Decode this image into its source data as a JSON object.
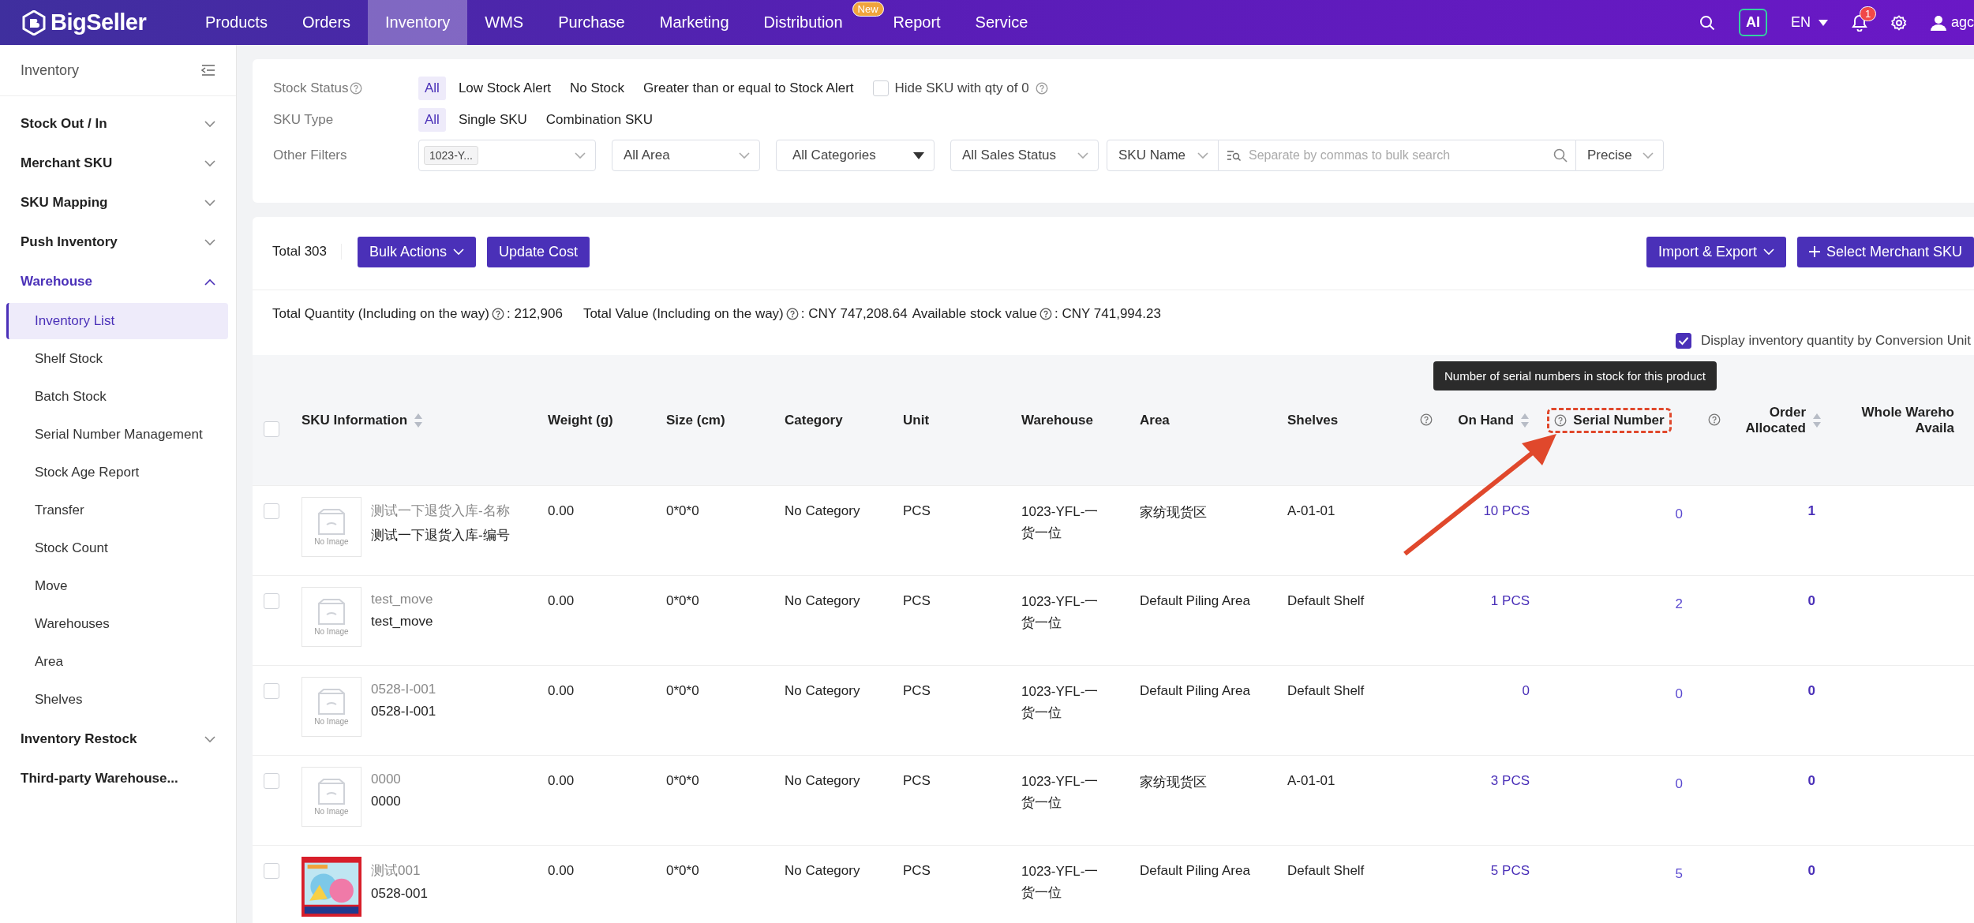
{
  "topbar": {
    "logo": "BigSeller",
    "nav": [
      {
        "label": "Products",
        "selected": false
      },
      {
        "label": "Orders",
        "selected": false
      },
      {
        "label": "Inventory",
        "selected": true
      },
      {
        "label": "WMS",
        "selected": false
      },
      {
        "label": "Purchase",
        "selected": false
      },
      {
        "label": "Marketing",
        "selected": false
      },
      {
        "label": "Distribution",
        "selected": false,
        "badge": "New"
      },
      {
        "label": "Report",
        "selected": false
      },
      {
        "label": "Service",
        "selected": false
      }
    ],
    "ai_button": "AI",
    "language": "EN",
    "notification_count": "1",
    "user": "agc"
  },
  "sidebar": {
    "title": "Inventory",
    "items": [
      {
        "label": "Stock Out / In",
        "expanded": false,
        "selected": false
      },
      {
        "label": "Merchant SKU",
        "expanded": false,
        "selected": false
      },
      {
        "label": "SKU Mapping",
        "expanded": false,
        "selected": false
      },
      {
        "label": "Push Inventory",
        "expanded": false,
        "selected": false
      },
      {
        "label": "Warehouse",
        "expanded": true,
        "selected": true,
        "children": [
          {
            "label": "Inventory List",
            "selected": true
          },
          {
            "label": "Shelf Stock",
            "selected": false
          },
          {
            "label": "Batch Stock",
            "selected": false
          },
          {
            "label": "Serial Number Management",
            "selected": false
          },
          {
            "label": "Stock Age Report",
            "selected": false
          },
          {
            "label": "Transfer",
            "selected": false
          },
          {
            "label": "Stock Count",
            "selected": false
          },
          {
            "label": "Move",
            "selected": false
          },
          {
            "label": "Warehouses",
            "selected": false
          },
          {
            "label": "Area",
            "selected": false
          },
          {
            "label": "Shelves",
            "selected": false
          }
        ]
      },
      {
        "label": "Inventory Restock",
        "expanded": false,
        "selected": false
      },
      {
        "label": "Third-party Warehouse...",
        "selected": false
      }
    ]
  },
  "filters": {
    "stock_status": {
      "label": "Stock Status",
      "options": [
        {
          "label": "All",
          "selected": true
        },
        {
          "label": "Low Stock Alert",
          "selected": false
        },
        {
          "label": "No Stock",
          "selected": false
        },
        {
          "label": "Greater than or equal to Stock Alert",
          "selected": false
        }
      ],
      "hide_zero": {
        "label": "Hide SKU with qty of 0",
        "checked": false
      }
    },
    "sku_type": {
      "label": "SKU Type",
      "options": [
        {
          "label": "All",
          "selected": true
        },
        {
          "label": "Single SKU",
          "selected": false
        },
        {
          "label": "Combination SKU",
          "selected": false
        }
      ]
    },
    "other": {
      "label": "Other Filters",
      "warehouse_tag": "1023-Y...",
      "area": "All Area",
      "categories": "All Categories",
      "sales_status": "All Sales Status",
      "search_by": "SKU Name",
      "search_placeholder": "Separate by commas to bulk search",
      "match": "Precise"
    }
  },
  "toolbar": {
    "total": "Total 303",
    "left_buttons": [
      {
        "label": "Bulk Actions",
        "dropdown": true,
        "plus": false
      },
      {
        "label": "Update Cost",
        "dropdown": false,
        "plus": false
      }
    ],
    "right_buttons": [
      {
        "label": "Import & Export",
        "dropdown": true,
        "plus": false
      },
      {
        "label": "Select Merchant SKU",
        "dropdown": false,
        "plus": true
      }
    ]
  },
  "summary": [
    {
      "label": "Total Quantity (Including on the way)",
      "value": ": 212,906"
    },
    {
      "label": "Total Value (Including on the way)",
      "value": ": CNY 747,208.64"
    },
    {
      "label": "Available stock value",
      "value": ": CNY 741,994.23"
    }
  ],
  "conversion_unit": {
    "label": "Display inventory quantity by Conversion Unit",
    "checked": true
  },
  "table": {
    "all_checked": false,
    "columns": [
      {
        "lines": [
          "SKU Information"
        ],
        "sortable": true,
        "help": false
      },
      {
        "lines": [
          "Weight (g)"
        ],
        "sortable": false,
        "help": false
      },
      {
        "lines": [
          "Size (cm)"
        ],
        "sortable": false,
        "help": false
      },
      {
        "lines": [
          "Category"
        ],
        "sortable": false,
        "help": false
      },
      {
        "lines": [
          "Unit"
        ],
        "sortable": false,
        "help": false
      },
      {
        "lines": [
          "Warehouse"
        ],
        "sortable": false,
        "help": false
      },
      {
        "lines": [
          "Area"
        ],
        "sortable": false,
        "help": false
      },
      {
        "lines": [
          "Shelves"
        ],
        "sortable": false,
        "help": false
      },
      {
        "lines": [
          "On Hand"
        ],
        "sortable": true,
        "help": true
      },
      {
        "lines": [
          "Serial Number"
        ],
        "sortable": false,
        "help": true,
        "highlighted": true,
        "tooltip": "Number of serial numbers in stock for this product"
      },
      {
        "lines": [
          "Order",
          "Allocated"
        ],
        "sortable": true,
        "help": true
      },
      {
        "lines": [
          "Whole Wareho",
          "Availa"
        ],
        "sortable": false
      }
    ],
    "rows": [
      {
        "checked": false,
        "image": {
          "kind": "placeholder",
          "label": "No Image"
        },
        "name": "测试一下退货入库-名称",
        "sku": "测试一下退货入库-编号",
        "weight": "0.00",
        "size": "0*0*0",
        "category": "No Category",
        "unit": "PCS",
        "warehouse": "1023-YFL-一货一位",
        "area": "家纺现货区",
        "shelf": "A-01-01",
        "on_hand": "10 PCS",
        "serial": "0",
        "allocated": "1"
      },
      {
        "checked": false,
        "image": {
          "kind": "placeholder",
          "label": "No Image"
        },
        "name": "test_move",
        "sku": "test_move",
        "weight": "0.00",
        "size": "0*0*0",
        "category": "No Category",
        "unit": "PCS",
        "warehouse": "1023-YFL-一货一位",
        "area": "Default Piling Area",
        "shelf": "Default Shelf",
        "on_hand": "1 PCS",
        "serial": "2",
        "allocated": "0"
      },
      {
        "checked": false,
        "image": {
          "kind": "placeholder",
          "label": "No Image"
        },
        "name": "0528-I-001",
        "sku": "0528-I-001",
        "weight": "0.00",
        "size": "0*0*0",
        "category": "No Category",
        "unit": "PCS",
        "warehouse": "1023-YFL-一货一位",
        "area": "Default Piling Area",
        "shelf": "Default Shelf",
        "on_hand": "0",
        "serial": "0",
        "allocated": "0"
      },
      {
        "checked": false,
        "image": {
          "kind": "placeholder",
          "label": "No Image"
        },
        "name": "0000",
        "sku": "0000",
        "weight": "0.00",
        "size": "0*0*0",
        "category": "No Category",
        "unit": "PCS",
        "warehouse": "1023-YFL-一货一位",
        "area": "家纺现货区",
        "shelf": "A-01-01",
        "on_hand": "3 PCS",
        "serial": "0",
        "allocated": "0"
      },
      {
        "checked": false,
        "name": "测试001",
        "sku": "0528-001",
        "weight": "0.00",
        "size": "0*0*0",
        "category": "No Category",
        "unit": "PCS",
        "warehouse": "1023-YFL-一货一位",
        "area": "Default Piling Area",
        "shelf": "Default Shelf",
        "on_hand": "5 PCS",
        "serial": "5",
        "allocated": "0"
      }
    ]
  }
}
